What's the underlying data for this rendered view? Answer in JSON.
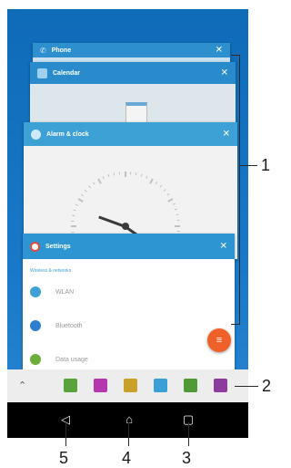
{
  "recents": {
    "cards": [
      {
        "title": "Phone"
      },
      {
        "title": "Calendar"
      },
      {
        "title": "Alarm & clock"
      },
      {
        "title": "Settings"
      }
    ],
    "settings": {
      "section": "Wireless & networks",
      "rows": [
        {
          "label": "WLAN",
          "icon": "wifi-icon",
          "color": "#3ea1d6"
        },
        {
          "label": "Bluetooth",
          "icon": "bluetooth-icon",
          "color": "#2f7fd0"
        },
        {
          "label": "Data usage",
          "icon": "data-usage-icon",
          "color": "#6cae3c"
        }
      ]
    },
    "close_symbol": "✕",
    "fab_symbol": "≡"
  },
  "small_apps": {
    "expand_symbol": "⌃",
    "apps": [
      {
        "icon": "small-app-1-icon",
        "color": "#5aa33a"
      },
      {
        "icon": "small-app-2-icon",
        "color": "#b437b0"
      },
      {
        "icon": "small-app-3-icon",
        "color": "#c9a02a"
      },
      {
        "icon": "small-app-4-icon",
        "color": "#3a9fd4"
      },
      {
        "icon": "small-app-5-icon",
        "color": "#4f9a35"
      },
      {
        "icon": "small-app-6-icon",
        "color": "#8d3c9e"
      }
    ]
  },
  "navbar": {
    "back_symbol": "◁",
    "home_symbol": "⌂",
    "recents_symbol": "▢"
  },
  "callouts": [
    "1",
    "2",
    "3",
    "4",
    "5"
  ]
}
